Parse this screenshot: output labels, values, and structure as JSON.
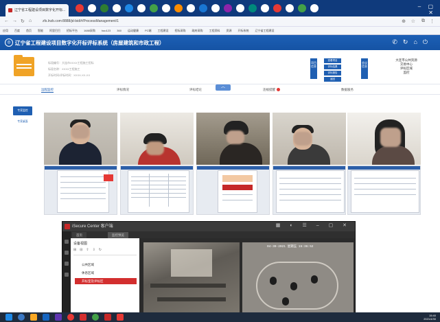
{
  "browser": {
    "tab_title": "辽宁省工程建设项目数字化开标...",
    "url": "zfs.lnzb.com:8888/jd-bid/#/ProcessManagement/1",
    "bookmarks": [
      "应用",
      "百度",
      "首页",
      "智能",
      "阿里巴巴",
      "招标平台",
      "1688采购",
      "hao123",
      "360",
      "运动健康",
      "PC端",
      "工程建设",
      "招标采购",
      "政府采购",
      "工程资料",
      "资源",
      "开标系统",
      "辽宁省工程建设"
    ]
  },
  "system": {
    "title": "辽宁省工程建设项目数字化开标评标系统（房屋建筑和市政工程）"
  },
  "project": {
    "info_labels": [
      "标段编号：",
      "标段名称：",
      "开标时间/评标时间："
    ],
    "info_values": [
      "大连市XXXX工程施工招标",
      "XXXX工程施工",
      "XXXX-XX-XX"
    ],
    "left_box": "项目信息",
    "right_box": "会议信息",
    "buttons": [
      "查看项目",
      "评标结果",
      "评标报告",
      "返回"
    ],
    "unit_lines": [
      "大连市公共资源",
      "交易中心",
      "评标区域",
      "监控"
    ]
  },
  "tabs": [
    {
      "label": "远程监控",
      "active": true
    },
    {
      "label": "评标情况",
      "active": false
    },
    {
      "label": "评标结论",
      "active": false
    },
    {
      "label": "违规提醒",
      "active": false,
      "badge": true
    },
    {
      "label": "数据服务",
      "active": false
    }
  ],
  "collapse_label": "︿",
  "left_nav": [
    {
      "label": "专家监控",
      "active": true
    },
    {
      "label": "专家桌面",
      "active": false
    }
  ],
  "ivms": {
    "title": "iSecure Center 客户端",
    "tabs": [
      "首页",
      "监控预览"
    ],
    "tree_title": "设备视图",
    "tree_items": [
      {
        "label": "公共区域",
        "selected": false
      },
      {
        "label": "休息区域",
        "selected": false
      },
      {
        "label": "开标室及评标区",
        "selected": true
      }
    ],
    "cam_timestamp_1": "",
    "cam_timestamp_2": "04-30-2021 星期五 15:36:52"
  },
  "clock": {
    "time": "15:40",
    "date": "2021/4/30"
  }
}
